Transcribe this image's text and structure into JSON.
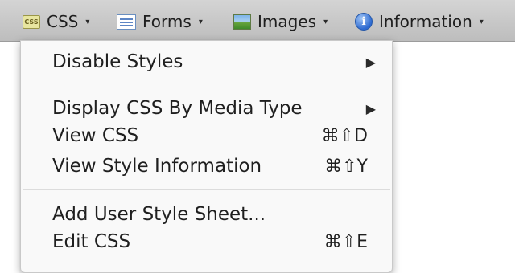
{
  "toolbar": {
    "items": [
      {
        "label": "CSS",
        "icon": "css-icon",
        "icon_text": "CSS"
      },
      {
        "label": "Forms",
        "icon": "forms-icon"
      },
      {
        "label": "Images",
        "icon": "images-icon"
      },
      {
        "label": "Information",
        "icon": "info-icon",
        "icon_text": "i"
      }
    ],
    "caret": "▾"
  },
  "menu": {
    "items": [
      {
        "label": "Disable Styles",
        "submenu_arrow": "▶"
      },
      {
        "label": "Display CSS By Media Type",
        "submenu_arrow": "▶"
      },
      {
        "label": "View CSS",
        "shortcut": "⌘⇧D"
      },
      {
        "label": "View Style Information",
        "shortcut": "⌘⇧Y"
      },
      {
        "label": "Add User Style Sheet..."
      },
      {
        "label": "Edit CSS",
        "shortcut": "⌘⇧E"
      }
    ]
  }
}
